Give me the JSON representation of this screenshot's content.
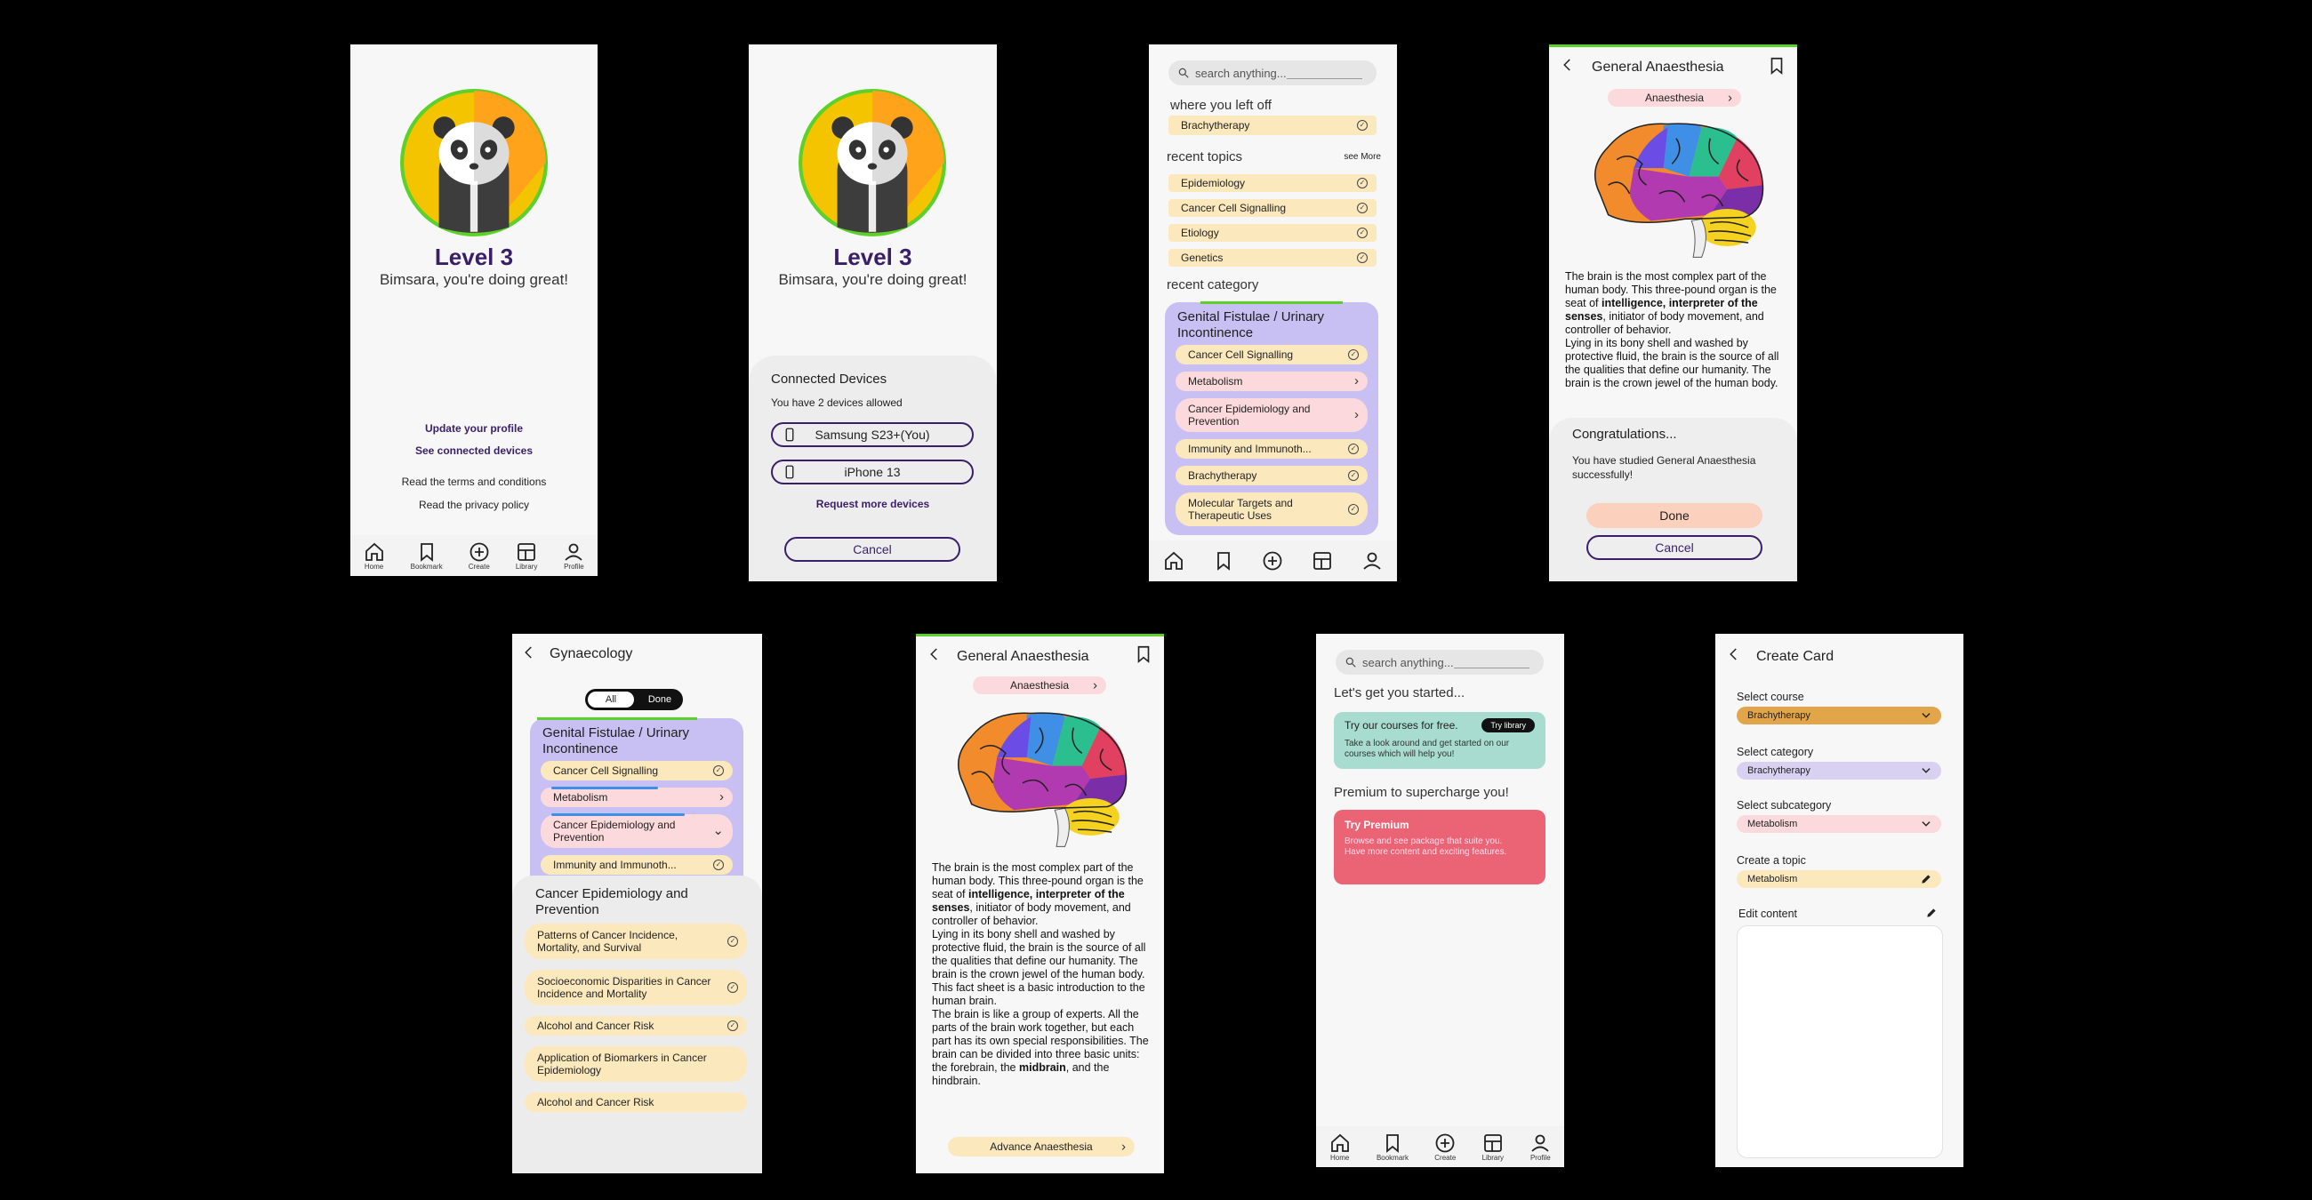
{
  "s1": {
    "level": "Level 3",
    "greeting": "Bimsara, you're doing great!",
    "links": [
      "Update your profile",
      "See connected devices"
    ],
    "plain": [
      "Read the terms and conditions",
      "Read the privacy policy"
    ],
    "nav": [
      "Home",
      "Bookmark",
      "Create",
      "Library",
      "Profile"
    ]
  },
  "s2": {
    "level": "Level 3",
    "greeting": "Bimsara, you're doing great!",
    "sheet_title": "Connected Devices",
    "allowed": "You have 2 devices allowed",
    "devices": [
      "Samsung S23+(You)",
      "iPhone 13"
    ],
    "request": "Request more devices",
    "cancel": "Cancel"
  },
  "s3": {
    "search_placeholder": "search anything...",
    "left_off_title": "where you left off",
    "left_off_item": "Brachytherapy",
    "recent_topics": "recent topics",
    "see_more": "see More",
    "topics": [
      "Epidemiology",
      "Cancer Cell Signalling",
      "Etiology",
      "Genetics"
    ],
    "recent_category": "recent category",
    "category_title": "Genital Fistulae / Urinary Incontinence",
    "category_items": [
      "Cancer Cell Signalling",
      "Metabolism",
      "Cancer Epidemiology and Prevention",
      "Immunity and Immunoth...",
      "Brachytherapy",
      "Molecular Targets and Therapeutic Uses"
    ]
  },
  "s4": {
    "title": "General Anaesthesia",
    "tag": "Anaesthesia",
    "paragraph_1": "The brain is the most complex part of the human body. This three-pound organ is the seat of ",
    "bold_1": "intelligence, interpreter of the senses",
    "paragraph_2": ", initiator of body movement, and controller of behavior.",
    "paragraph_3": "Lying in its bony shell and washed by protective fluid, the brain is the source of all the qualities that define our humanity. The brain is the crown jewel of the human body.",
    "congrats_title": "Congratulations...",
    "congrats_text": "You have studied General Anaesthesia successfully!",
    "done": "Done",
    "cancel": "Cancel"
  },
  "s5": {
    "title": "Gynaecology",
    "toggle": [
      "All",
      "Done"
    ],
    "category_title": "Genital Fistulae / Urinary Incontinence",
    "category_items": [
      "Cancer Cell Signalling",
      "Metabolism",
      "Cancer Epidemiology and Prevention",
      "Immunity and Immunoth..."
    ],
    "sub_title": "Cancer Epidemiology and Prevention",
    "sub_items": [
      "Patterns of Cancer Incidence, Mortality, and Survival",
      "Socioeconomic Disparities in Cancer Incidence and Mortality",
      "Alcohol and Cancer Risk",
      "Application of Biomarkers in Cancer Epidemiology",
      "Alcohol and Cancer Risk"
    ]
  },
  "s6": {
    "title": "General Anaesthesia",
    "tag": "Anaesthesia",
    "paragraph_1": "The brain is the most complex part of the human body. This three-pound organ is the seat of ",
    "bold_1": "intelligence, interpreter of the senses",
    "paragraph_2": ", initiator of body movement, and controller of behavior.",
    "paragraph_3": "Lying in its bony shell and washed by protective fluid, the brain is the source of all the qualities that define our humanity. The brain is the crown jewel of the human body.",
    "paragraph_4": "This fact sheet is a basic introduction to the human brain.",
    "paragraph_5": "The brain is like a group of experts. All the parts of the brain work together, but each part has its own special responsibilities. The brain can be divided into three basic units: the forebrain, the ",
    "bold_2": "midbrain",
    "paragraph_6": ", and the hindbrain.",
    "advance": "Advance Anaesthesia"
  },
  "s7": {
    "search_placeholder": "search anything...",
    "started": "Let's get you started...",
    "free_title": "Try our courses for free.",
    "free_btn": "Try library",
    "free_text": "Take a look around and get started on our courses which will help you!",
    "premium_heading": "Premium to supercharge you!",
    "premium_title": "Try Premium",
    "premium_text": "Browse and see package that suite you. Have more content and exciting features.",
    "nav": [
      "Home",
      "Bookmark",
      "Create",
      "Library",
      "Profile"
    ]
  },
  "s8": {
    "title": "Create Card",
    "labels": [
      "Select course",
      "Select category",
      "Select subcategory",
      "Create a topic",
      "Edit content"
    ],
    "values": [
      "Brachytherapy",
      "Brachytherapy",
      "Metabolism",
      "Metabolism"
    ]
  },
  "colors": {
    "accent": "#3a1f68",
    "green": "#5cd12a",
    "yellow": "#fbe9bd",
    "pink": "#fbd9dc",
    "lavender": "#c8c0f2"
  }
}
